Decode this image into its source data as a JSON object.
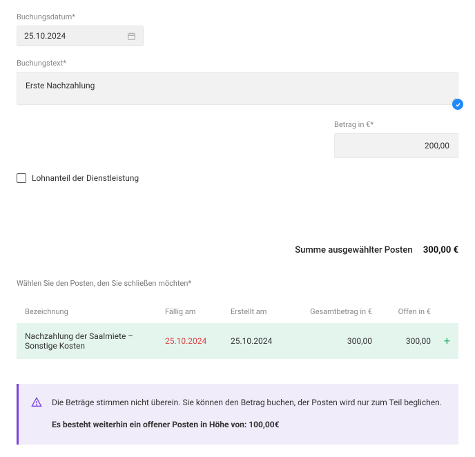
{
  "bookingDate": {
    "label": "Buchungsdatum*",
    "value": "25.10.2024"
  },
  "bookingText": {
    "label": "Buchungstext*",
    "value": "Erste Nachzahlung"
  },
  "amount": {
    "label": "Betrag in €*",
    "value": "200,00"
  },
  "wageCheckbox": {
    "label": "Lohnanteil der Dienstleistung",
    "checked": false
  },
  "sumSelected": {
    "label": "Summe ausgewählter Posten",
    "value": "300,00 €"
  },
  "choosePostLabel": "Wählen Sie den Posten, den Sie schließen möchten*",
  "table": {
    "headers": {
      "name": "Bezeichnung",
      "due": "Fällig am",
      "created": "Erstellt am",
      "total": "Gesamtbetrag in €",
      "open": "Offen in €"
    },
    "rows": [
      {
        "name": "Nachzahlung der Saalmiete – Sonstige Kosten",
        "due": "25.10.2024",
        "created": "25.10.2024",
        "total": "300,00",
        "open": "300,00"
      }
    ]
  },
  "alert": {
    "line1": "Die Beträge stimmen nicht überein. Sie können den Betrag buchen, der Posten wird nur zum Teil beglichen.",
    "line2": "Es besteht weiterhin ein offener Posten in Höhe von: 100,00€"
  }
}
